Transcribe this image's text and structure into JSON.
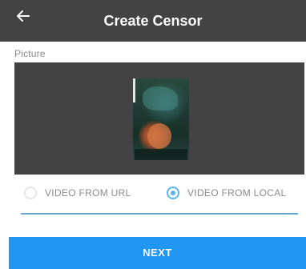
{
  "appbar": {
    "title": "Create Censor",
    "back_icon": "arrow-left-icon",
    "background": "#434343"
  },
  "picture": {
    "label": "Picture",
    "background": "#434343"
  },
  "source_options": {
    "items": [
      {
        "label": "VIDEO FROM URL",
        "checked": false
      },
      {
        "label": "VIDEO FROM LOCAL",
        "checked": true
      }
    ],
    "accent": "#5ab6ec"
  },
  "input": {
    "value": "",
    "underline_color": "#6aa8d8"
  },
  "actions": {
    "next_label": "NEXT",
    "next_color": "#2196f3"
  }
}
